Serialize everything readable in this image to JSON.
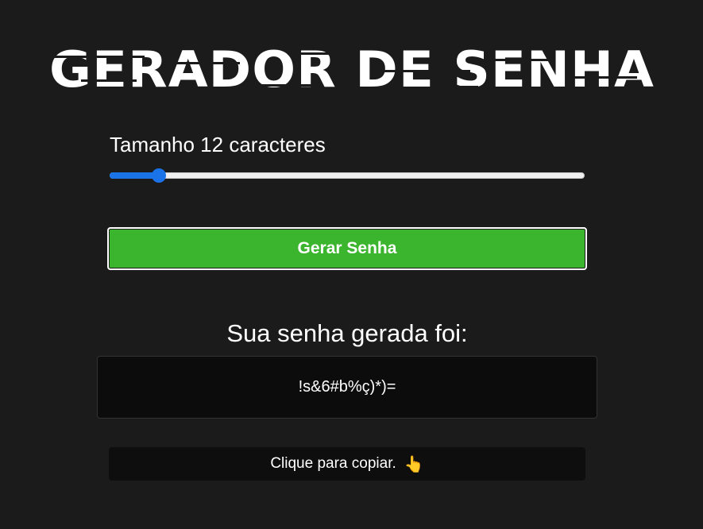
{
  "header": {
    "title": "GERADOR DE SENHA"
  },
  "length": {
    "label": "Tamanho 12 caracteres",
    "value": 12,
    "min": 8,
    "max": 64
  },
  "generate_button": {
    "label": "Gerar Senha"
  },
  "result": {
    "heading": "Sua senha gerada foi:",
    "password": "!s&6#b%ç)*)="
  },
  "copy": {
    "label": "Clique para copiar.",
    "icon": "pointing-hand-icon"
  },
  "colors": {
    "background": "#1b1b1b",
    "accent_green": "#3bb52e",
    "slider_blue": "#1a73e8",
    "box_dark": "#0c0c0c"
  }
}
